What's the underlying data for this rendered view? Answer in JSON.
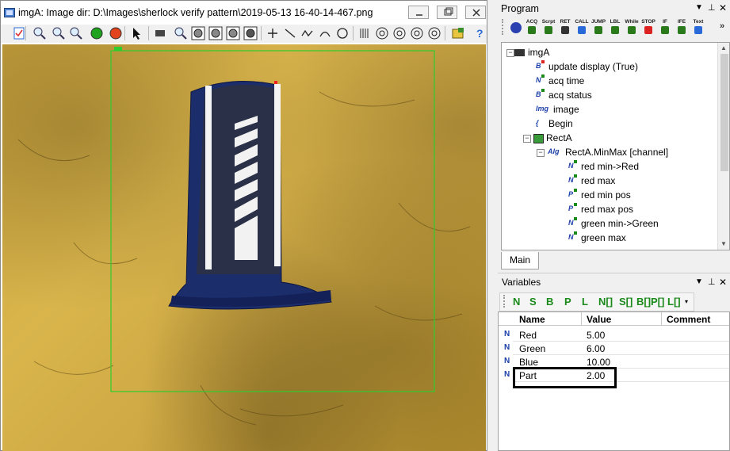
{
  "image_window": {
    "title": "imgA: Image dir: D:\\Images\\sherlock verify pattern\\2019-05-13 16-40-14-467.png",
    "toolbar_icons": [
      "checklist-icon",
      "zoom-out-icon",
      "zoom-in-icon",
      "zoom-fit-icon",
      "run-green-icon",
      "stop-red-icon",
      "pointer-icon",
      "rectangle-icon",
      "arc-icon",
      "rect-roi-icon",
      "circle-roi-icon",
      "polygon-roi-icon",
      "mask-roi-icon",
      "cross-icon",
      "line-icon",
      "polyline-icon",
      "arc-line-icon",
      "circle-icon",
      "rake-icon",
      "spoke-icon",
      "starburst-icon",
      "rainbow-icon",
      "bullseye-icon",
      "transfer-icon",
      "help-icon"
    ]
  },
  "program": {
    "title": "Program",
    "toolbar_labels": [
      "ACQ",
      "Scrpt",
      "RET",
      "CALL",
      "JUMP",
      "LBL",
      "While",
      "STOP",
      "IF",
      "IFE",
      "Text"
    ],
    "tree": [
      {
        "label": "imgA",
        "level": 0
      },
      {
        "label": "update display (True)",
        "level": 1,
        "icon": "B"
      },
      {
        "label": "acq time",
        "level": 1,
        "icon": "N"
      },
      {
        "label": "acq status",
        "level": 1,
        "icon": "B"
      },
      {
        "label": "image",
        "level": 1,
        "icon": "Img"
      },
      {
        "label": "Begin",
        "level": 1,
        "icon": "{"
      },
      {
        "label": "RectA",
        "level": 1
      },
      {
        "label": "RectA.MinMax [channel]",
        "level": 2,
        "icon": "Alg"
      },
      {
        "label": "red min->Red",
        "level": 3,
        "icon": "N"
      },
      {
        "label": "red max",
        "level": 3,
        "icon": "N"
      },
      {
        "label": "red min pos",
        "level": 3,
        "icon": "P"
      },
      {
        "label": "red max pos",
        "level": 3,
        "icon": "P"
      },
      {
        "label": "green min->Green",
        "level": 3,
        "icon": "N"
      },
      {
        "label": "green max",
        "level": 3,
        "icon": "N"
      }
    ],
    "tab": "Main"
  },
  "variables": {
    "title": "Variables",
    "type_buttons": [
      "N",
      "S",
      "B",
      "P",
      "L",
      "N[]",
      "S[]",
      "B[]",
      "P[]",
      "L[]"
    ],
    "columns": [
      "Name",
      "Value",
      "Comment"
    ],
    "rows": [
      {
        "type": "N",
        "name": "Red",
        "value": "5.00"
      },
      {
        "type": "N",
        "name": "Green",
        "value": "6.00"
      },
      {
        "type": "N",
        "name": "Blue",
        "value": "10.00"
      },
      {
        "type": "N",
        "name": "Part",
        "value": "2.00"
      }
    ]
  }
}
